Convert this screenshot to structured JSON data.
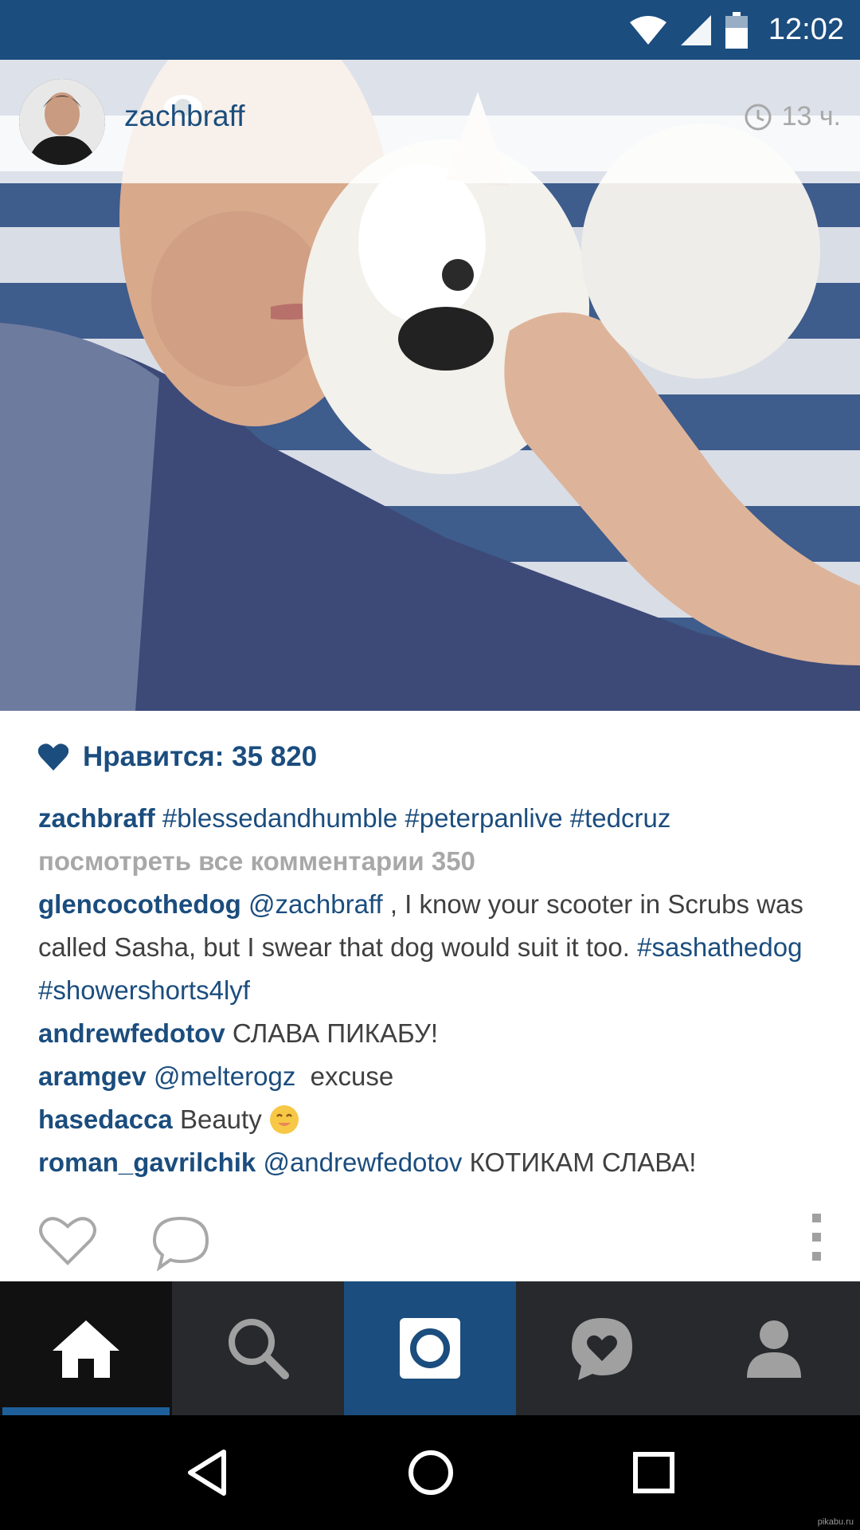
{
  "status_bar": {
    "time": "12:02"
  },
  "post": {
    "username": "zachbraff",
    "time_ago": "13 ч.",
    "likes_label": "Нравится: 35 820",
    "caption": {
      "user": "zachbraff",
      "text": "#blessedandhumble #peterpanlive #tedcruz"
    },
    "view_all_comments": "посмотреть все комментарии 350",
    "comments": [
      {
        "user": "glencocothedog",
        "mention": "@zachbraff",
        "text": " , I know your scooter in Scrubs was called Sasha, but I swear that dog would suit it too. ",
        "tags": "#sashathedog #showershorts4lyf"
      },
      {
        "user": "andrewfedotov",
        "mention": "",
        "text": "СЛАВА ПИКАБУ!",
        "tags": ""
      },
      {
        "user": "aramgev",
        "mention": "@melterogz",
        "text": "  excuse",
        "tags": ""
      },
      {
        "user": "hasedacca",
        "mention": "",
        "text": "Beauty",
        "tags": ""
      },
      {
        "user": "roman_gavrilchik",
        "mention": "@andrewfedotov",
        "text": " КОТИКАМ СЛАВА!",
        "tags": ""
      }
    ]
  },
  "icons": {
    "like": "heart-outline-icon",
    "comment": "comment-bubble-icon",
    "more": "more-vertical-icon",
    "tabs": [
      "home-icon",
      "search-icon",
      "camera-icon",
      "activity-heart-icon",
      "profile-icon"
    ],
    "nav": [
      "back-icon",
      "home-circle-icon",
      "recents-icon"
    ]
  },
  "colors": {
    "accent": "#1b4d7e",
    "tab_bar": "#27292d"
  },
  "watermark": "pikabu.ru"
}
